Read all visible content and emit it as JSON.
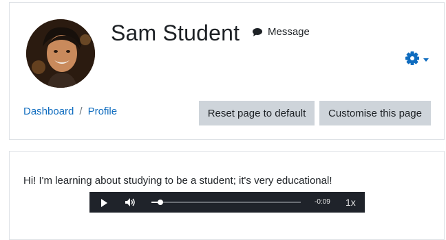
{
  "profile": {
    "name": "Sam Student",
    "message_label": "Message"
  },
  "breadcrumb": {
    "items": [
      {
        "label": "Dashboard"
      },
      {
        "label": "Profile"
      }
    ],
    "separator": "/"
  },
  "actions": {
    "reset_label": "Reset page to default",
    "customise_label": "Customise this page"
  },
  "post": {
    "text": "Hi! I'm learning about studying to be a student; it's very educational!"
  },
  "audio_player": {
    "time_remaining": "-0:09",
    "speed": "1x",
    "progress": 0.06
  },
  "colors": {
    "link": "#0f6cbf",
    "button_bg": "#ced4da",
    "player_bg": "#1f232a"
  }
}
